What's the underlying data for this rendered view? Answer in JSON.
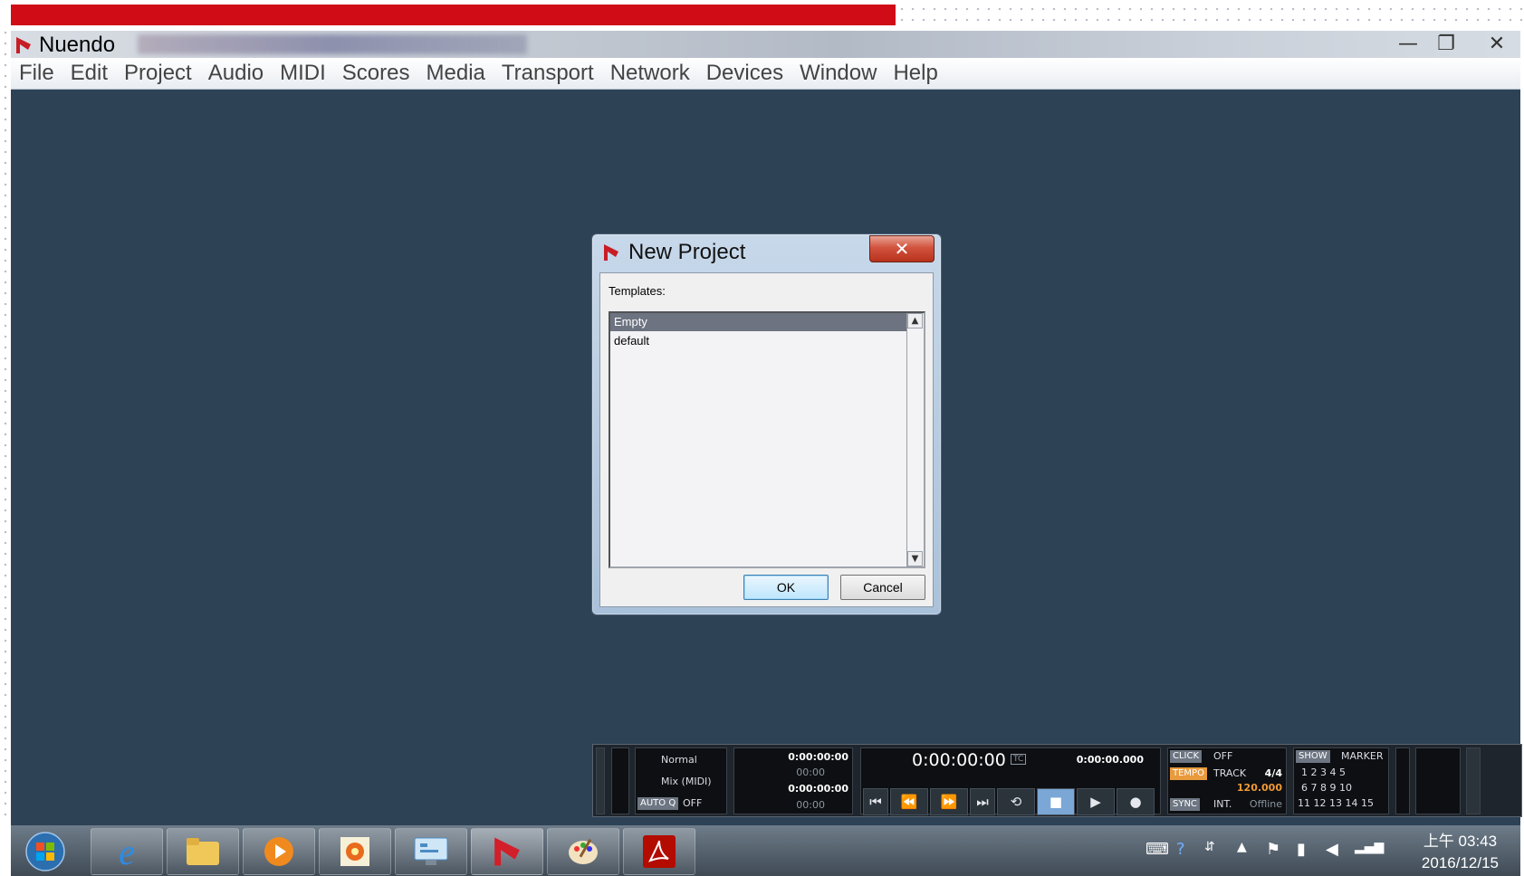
{
  "window": {
    "app_title": "Nuendo",
    "controls": {
      "minimize": "—",
      "restore": "❐",
      "close": "✕"
    }
  },
  "menu": [
    "File",
    "Edit",
    "Project",
    "Audio",
    "MIDI",
    "Scores",
    "Media",
    "Transport",
    "Network",
    "Devices",
    "Window",
    "Help"
  ],
  "dialog": {
    "title": "New Project",
    "close": "✕",
    "templates_label": "Templates:",
    "templates": [
      "Empty",
      "default"
    ],
    "selected": "Empty",
    "ok": "OK",
    "cancel": "Cancel"
  },
  "transport": {
    "mode": "Normal",
    "mix": "Mix (MIDI)",
    "autoq_label": "AUTO Q",
    "autoq_value": "OFF",
    "left_locator": "0:00:00:00",
    "left_sub": "00:00",
    "right_locator": "0:00:00:00",
    "right_sub": "00:00",
    "primary_time": "0:00:00:00",
    "primary_format": "TC",
    "secondary_time": "0:00:00.000",
    "click_label": "CLICK",
    "click_value": "OFF",
    "tempo_label": "TEMPO",
    "tempo_mode": "TRACK",
    "signature": "4/4",
    "tempo_value": "120.000",
    "sync_label": "SYNC",
    "sync_mode": "INT.",
    "sync_status": "Offline",
    "show_label": "SHOW",
    "marker_label": "MARKER",
    "markers_row1": "1  2  3  4  5",
    "markers_row2": "6  7  8  9  10",
    "markers_row3": "11 12 13 14 15",
    "buttons": {
      "to_start": "⏮",
      "rewind": "⏪",
      "forward": "⏩",
      "to_end": "⏭",
      "cycle": "⟲",
      "stop": "■",
      "play": "▶",
      "record": "●"
    }
  },
  "taskbar": {
    "apps": [
      "start",
      "internet-explorer",
      "file-explorer",
      "media-player",
      "photo-gallery",
      "control-panel",
      "nuendo",
      "paint",
      "acrobat"
    ],
    "clock_time": "上午 03:43",
    "clock_date": "2016/12/15"
  }
}
